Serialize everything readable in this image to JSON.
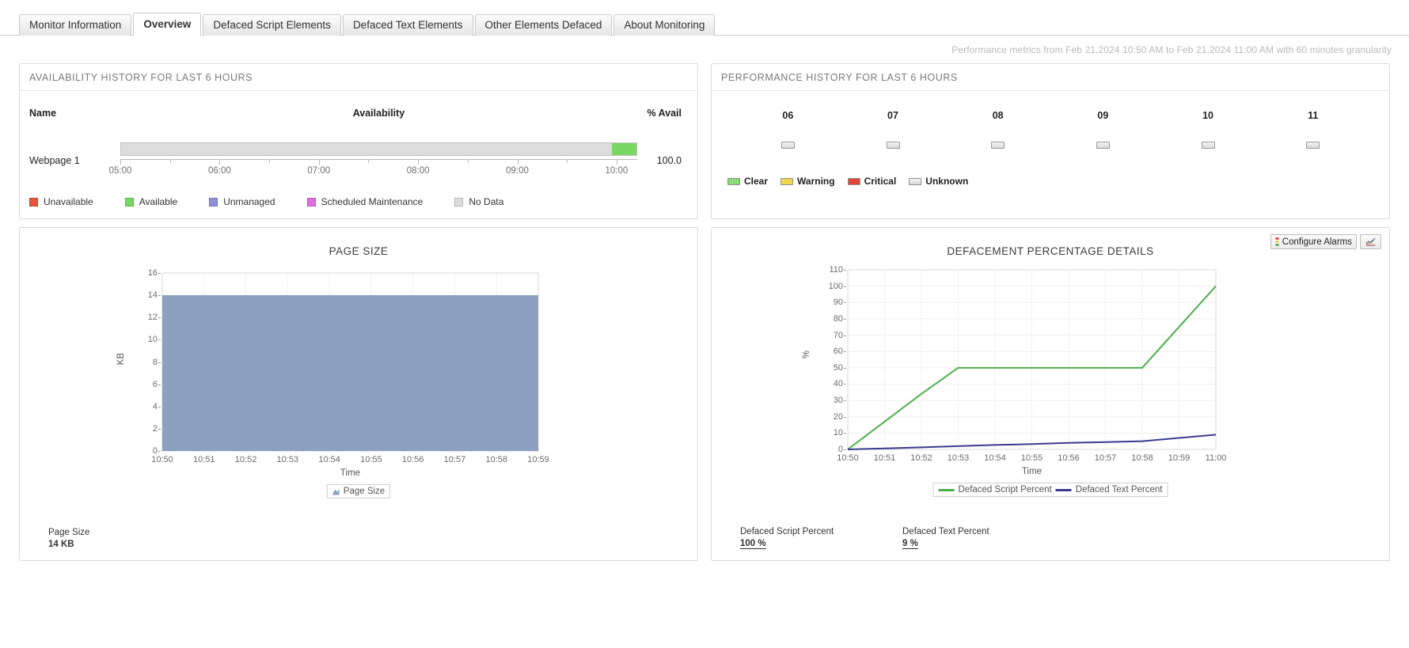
{
  "tabs": [
    {
      "label": "Monitor Information",
      "active": false
    },
    {
      "label": "Overview",
      "active": true
    },
    {
      "label": "Defaced Script Elements",
      "active": false
    },
    {
      "label": "Defaced Text Elements",
      "active": false
    },
    {
      "label": "Other Elements Defaced",
      "active": false
    },
    {
      "label": "About Monitoring",
      "active": false
    }
  ],
  "metrics_note": "Performance metrics from Feb 21,2024 10:50 AM to Feb 21,2024 11:00 AM with 60 minutes granularity",
  "availability": {
    "panel_title": "AVAILABILITY HISTORY FOR LAST 6 HOURS",
    "columns": {
      "name": "Name",
      "availability": "Availability",
      "percent": "% Avail"
    },
    "rows": [
      {
        "name": "Webpage 1",
        "percent": "100.0",
        "available_fraction": 0.048
      }
    ],
    "time_ticks": [
      "05:00",
      "06:00",
      "07:00",
      "08:00",
      "09:00",
      "10:00"
    ],
    "legend": [
      {
        "label": "Unavailable",
        "color": "#e4553a"
      },
      {
        "label": "Available",
        "color": "#79d763"
      },
      {
        "label": "Unmanaged",
        "color": "#8f90d8"
      },
      {
        "label": "Scheduled Maintenance",
        "color": "#e070e0"
      },
      {
        "label": "No Data",
        "color": "#dcdcdc"
      }
    ]
  },
  "performance": {
    "panel_title": "PERFORMANCE HISTORY FOR LAST 6 HOURS",
    "hours": [
      "06",
      "07",
      "08",
      "09",
      "10",
      "11"
    ],
    "states": [
      "Unknown",
      "Unknown",
      "Unknown",
      "Unknown",
      "Unknown",
      "Unknown"
    ],
    "legend": [
      {
        "label": "Clear",
        "color": "#79d763"
      },
      {
        "label": "Warning",
        "color": "#f2d64b"
      },
      {
        "label": "Critical",
        "color": "#e0463a"
      },
      {
        "label": "Unknown",
        "color": "#dcdcdc"
      }
    ]
  },
  "page_size_panel": {
    "footer": [
      {
        "label": "Page Size",
        "value": "14 KB",
        "underline": false
      }
    ]
  },
  "defacement_panel": {
    "configure_alarms_label": "Configure Alarms",
    "export_icon": "chart-export-icon",
    "footer": [
      {
        "label": "Defaced Script Percent",
        "value": "100 %",
        "underline": true
      },
      {
        "label": "Defaced Text Percent",
        "value": "9 %",
        "underline": true
      }
    ]
  },
  "chart_data": [
    {
      "type": "area",
      "title": "PAGE SIZE",
      "xlabel": "Time",
      "ylabel": "KB",
      "ylim": [
        0,
        16
      ],
      "yticks": [
        0,
        2,
        4,
        6,
        8,
        10,
        12,
        14,
        16
      ],
      "grid": true,
      "legend_position": "bottom",
      "x": [
        "10:50",
        "10:51",
        "10:52",
        "10:53",
        "10:54",
        "10:55",
        "10:56",
        "10:57",
        "10:58",
        "10:59"
      ],
      "xticks": [
        "10:50",
        "10:51",
        "10:52",
        "10:53",
        "10:54",
        "10:55",
        "10:56",
        "10:57",
        "10:58",
        "10:59"
      ],
      "series": [
        {
          "name": "Page Size",
          "color": "#8ca0c0",
          "values": [
            14,
            14,
            14,
            14,
            14,
            14,
            14,
            14,
            14,
            14
          ]
        }
      ]
    },
    {
      "type": "line",
      "title": "DEFACEMENT PERCENTAGE DETAILS",
      "xlabel": "Time",
      "ylabel": "%",
      "ylim": [
        0,
        110
      ],
      "yticks": [
        0,
        10,
        20,
        30,
        40,
        50,
        60,
        70,
        80,
        90,
        100,
        110
      ],
      "grid": true,
      "legend_position": "bottom",
      "x": [
        "10:50",
        "10:51",
        "10:52",
        "10:53",
        "10:54",
        "10:55",
        "10:56",
        "10:57",
        "10:58",
        "10:59",
        "11:00"
      ],
      "xticks": [
        "10:50",
        "10:51",
        "10:52",
        "10:53",
        "10:54",
        "10:55",
        "10:56",
        "10:57",
        "10:58",
        "10:59",
        "11:00"
      ],
      "series": [
        {
          "name": "Defaced Script Percent",
          "color": "#4caf4c",
          "values": [
            0,
            17,
            34,
            50,
            50,
            50,
            50,
            50,
            50,
            75,
            100
          ]
        },
        {
          "name": "Defaced Text Percent",
          "color": "#3b3b8f",
          "values": [
            0,
            0.6,
            1.3,
            2,
            2.7,
            3.3,
            4,
            4.5,
            5,
            7,
            9
          ]
        }
      ]
    }
  ]
}
